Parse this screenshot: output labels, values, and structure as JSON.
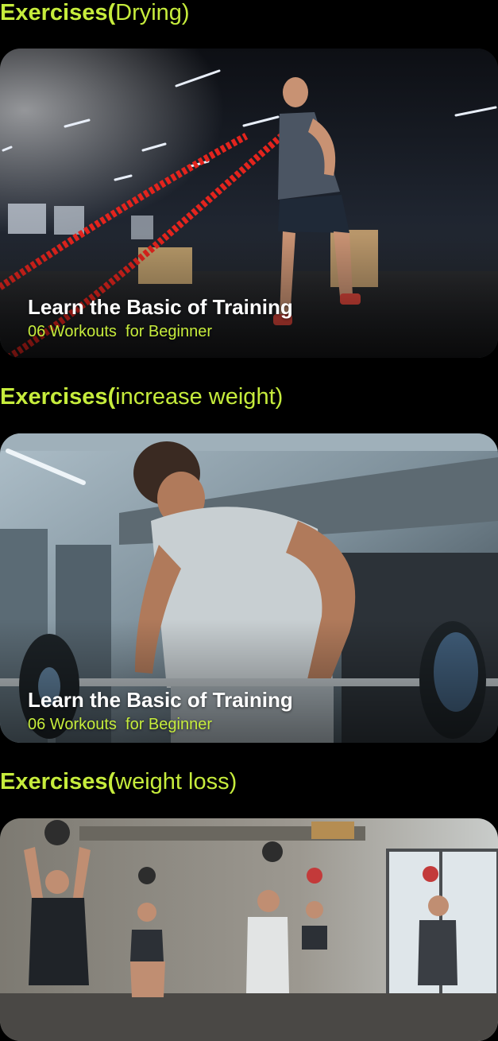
{
  "sections": [
    {
      "title_bold": "Exercises(",
      "title_rest": "Drying)",
      "card": {
        "image": "battle-ropes-workout-photo",
        "title": "Learn the Basic of Training",
        "subtitle": "06 Workouts  for Beginner"
      }
    },
    {
      "title_bold": "Exercises(",
      "title_rest": "increase weight)",
      "card": {
        "image": "barbell-lift-workout-photo",
        "title": "Learn the Basic of Training",
        "subtitle": "06 Workouts  for Beginner"
      }
    },
    {
      "title_bold": "Exercises(",
      "title_rest": "weight loss)",
      "card": {
        "image": "medicine-ball-group-workout-photo",
        "title": "",
        "subtitle": ""
      }
    }
  ],
  "colors": {
    "accent": "#c6ec3c",
    "background": "#000000",
    "card_title": "#ffffff"
  }
}
